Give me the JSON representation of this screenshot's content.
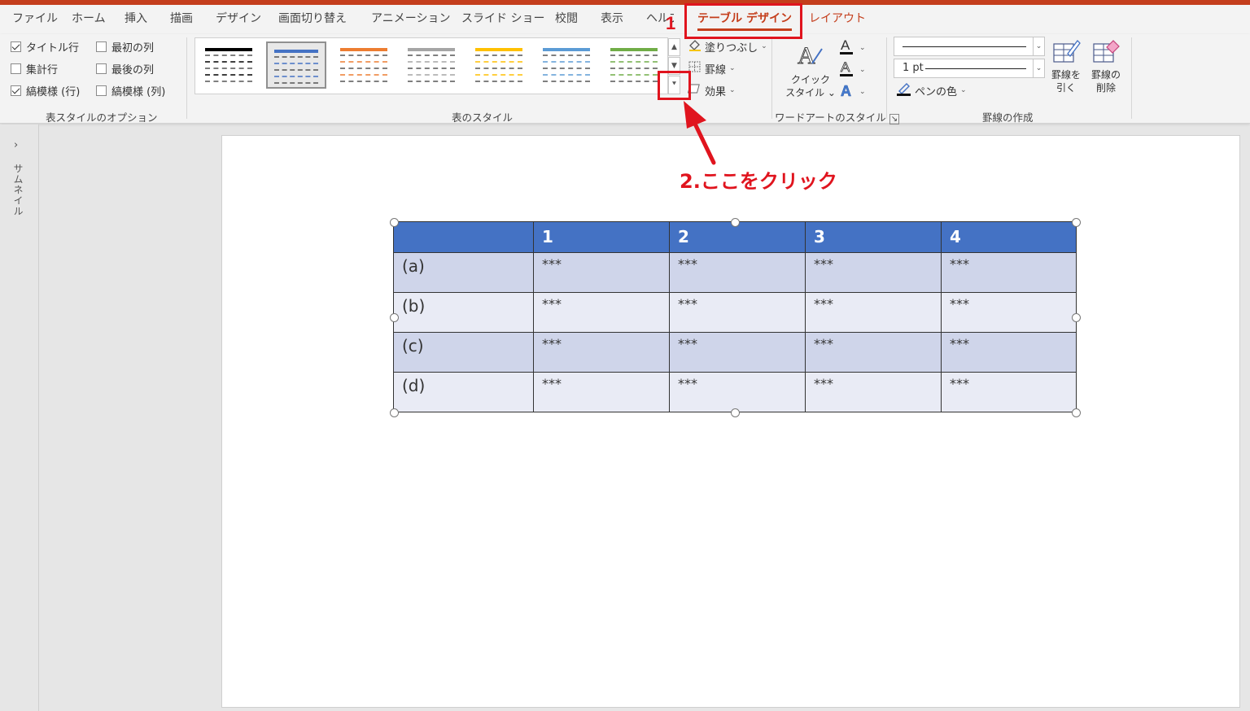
{
  "ribbon_tabs": [
    "ファイル",
    "ホーム",
    "挿入",
    "描画",
    "デザイン",
    "画面切り替え",
    "アニメーション",
    "スライド ショー",
    "校閲",
    "表示",
    "ヘルプ",
    "テーブル デザイン",
    "レイアウト"
  ],
  "active_tab": "テーブル デザイン",
  "table_style_options": {
    "items": [
      {
        "label": "タイトル行",
        "checked": true
      },
      {
        "label": "最初の列",
        "checked": false
      },
      {
        "label": "集計行",
        "checked": false
      },
      {
        "label": "最後の列",
        "checked": false
      },
      {
        "label": "縞模様 (行)",
        "checked": true
      },
      {
        "label": "縞模様 (列)",
        "checked": false
      }
    ],
    "group_label": "表スタイルのオプション"
  },
  "table_styles": {
    "group_label": "表のスタイル",
    "swatches": [
      "#000000",
      "#4472c4",
      "#ed7d31",
      "#a5a5a5",
      "#ffc000",
      "#5b9bd5",
      "#70ad47"
    ],
    "selected_index": 1,
    "shading": "塗りつぶし",
    "borders": "罫線",
    "effects": "効果"
  },
  "wordart": {
    "quick_styles": "クイック\nスタイル",
    "quick_styles_line1": "クイック",
    "quick_styles_line2": "スタイル",
    "group_label": "ワードアートのスタイル"
  },
  "borders_draw": {
    "pen_weight": "1 pt",
    "pen_color": "ペンの色",
    "draw_table_line1": "罫線を",
    "draw_table_line2": "引く",
    "eraser_line1": "罫線の",
    "eraser_line2": "削除",
    "group_label": "罫線の作成"
  },
  "thumbnail_pane": {
    "label": "サムネイル"
  },
  "slide_table": {
    "header": [
      "",
      "1",
      "2",
      "3",
      "4"
    ],
    "rows": [
      [
        "(a)",
        "***",
        "***",
        "***",
        "***"
      ],
      [
        "(b)",
        "***",
        "***",
        "***",
        "***"
      ],
      [
        "(c)",
        "***",
        "***",
        "***",
        "***"
      ],
      [
        "(d)",
        "***",
        "***",
        "***",
        "***"
      ]
    ]
  },
  "annotations": {
    "step1": "1",
    "step2": "2.ここをクリック",
    "color": "#e0141e"
  }
}
